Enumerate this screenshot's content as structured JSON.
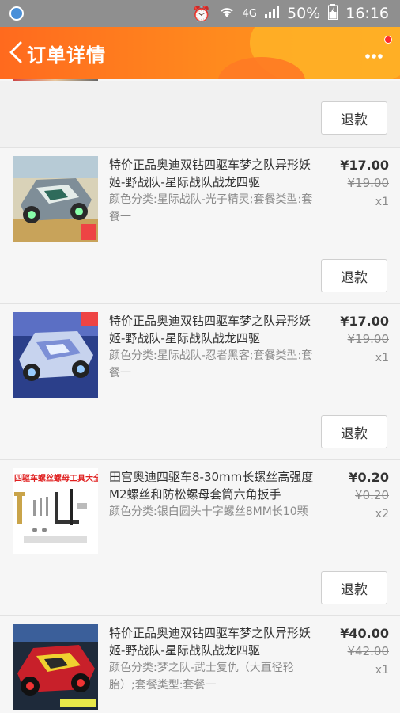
{
  "status_bar": {
    "network": "4G",
    "battery": "50%",
    "time": "16:16"
  },
  "header": {
    "title": "订单详情",
    "accent_color": "#ff7a1e"
  },
  "refund_label": "退款",
  "items": [
    {
      "name": "特价正品奥迪双钻四驱车梦之队异形妖姬-野战队-星际战队战龙四驱",
      "sku": "颜色分类:星际战队-光子精灵;套餐类型:套餐一",
      "price": "¥17.00",
      "original_price": "¥19.00",
      "qty": "x1"
    },
    {
      "name": "特价正品奥迪双钻四驱车梦之队异形妖姬-野战队-星际战队战龙四驱",
      "sku": "颜色分类:星际战队-忍者黑客;套餐类型:套餐一",
      "price": "¥17.00",
      "original_price": "¥19.00",
      "qty": "x1"
    },
    {
      "name": "田宫奥迪四驱车8-30mm长螺丝高强度M2螺丝和防松螺母套筒六角扳手",
      "sku": "颜色分类:银白圆头十字螺丝8MM长10颗",
      "price": "¥0.20",
      "original_price": "¥0.20",
      "qty": "x2",
      "thumb_caption": "四驱车螺丝螺母工具大全"
    },
    {
      "name": "特价正品奥迪双钻四驱车梦之队异形妖姬-野战队-星际战队战龙四驱",
      "sku": "颜色分类:梦之队-武士复仇（大直径轮胎）;套餐类型:套餐一",
      "price": "¥40.00",
      "original_price": "¥42.00",
      "qty": "x1"
    }
  ]
}
